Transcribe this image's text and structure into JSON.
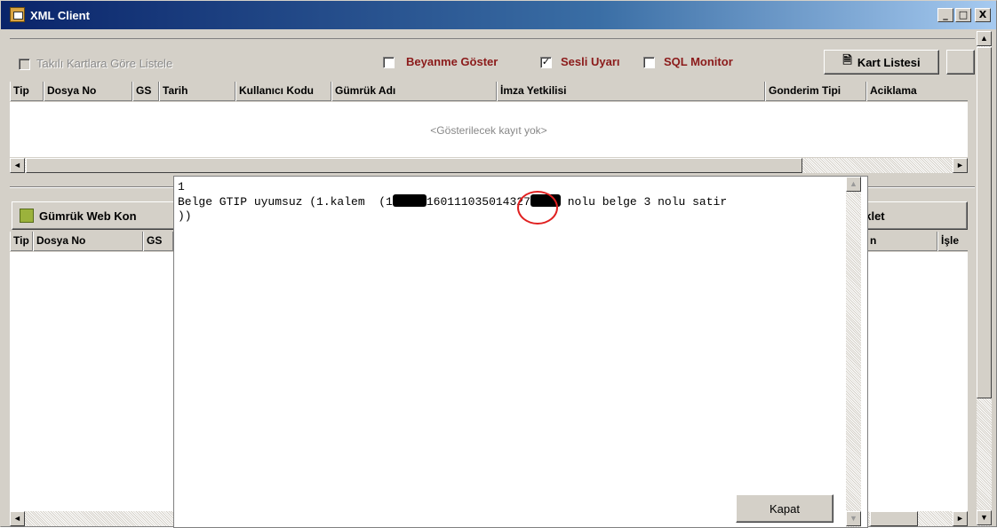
{
  "window": {
    "title": "XML Client",
    "controls": {
      "minimize": "_",
      "maximize": "□",
      "close": "X"
    }
  },
  "toolbar": {
    "takili_kartlara": {
      "label": "Takılı Kartlara Göre Listele",
      "checked": false,
      "enabled": false
    },
    "beyanname_goster": {
      "label": "Beyanme Göster",
      "checked": false
    },
    "sesli_uyari": {
      "label": "Sesli Uyarı",
      "checked": true
    },
    "sql_monitor": {
      "label": "SQL Monitor",
      "checked": false
    },
    "kart_listesi_button": "Kart Listesi"
  },
  "top_grid": {
    "columns": [
      "Tip",
      "Dosya No",
      "GS",
      "Tarih",
      "Kullanıcı Kodu",
      "Gümrük Adı",
      "İmza Yetkilisi",
      "Gonderim Tipi",
      "Aciklama"
    ],
    "empty_text": "<Gösterilecek kayıt yok>"
  },
  "bottom_panel": {
    "web_button": "Gümrük Web Kon",
    "right_button": "eklet",
    "columns_left": [
      "Tip",
      "Dosya No",
      "GS"
    ],
    "columns_right": [
      "n",
      "İşle"
    ]
  },
  "message_dialog": {
    "line1": "1",
    "line2_a": "Belge GTIP uyumsuz (1.kalem  (1",
    "line2_b": "16011",
    "line2_c": "1035",
    "line2_d": "014327",
    "line2_e": "nolu belge 3 nolu satir",
    "line3": "))",
    "close_button": "Kapat"
  },
  "colors": {
    "title_start": "#0a246a",
    "title_end": "#a6caf0",
    "face": "#d4d0c8",
    "accent_red": "#8b1a1a",
    "highlight_circle": "#e02020"
  }
}
